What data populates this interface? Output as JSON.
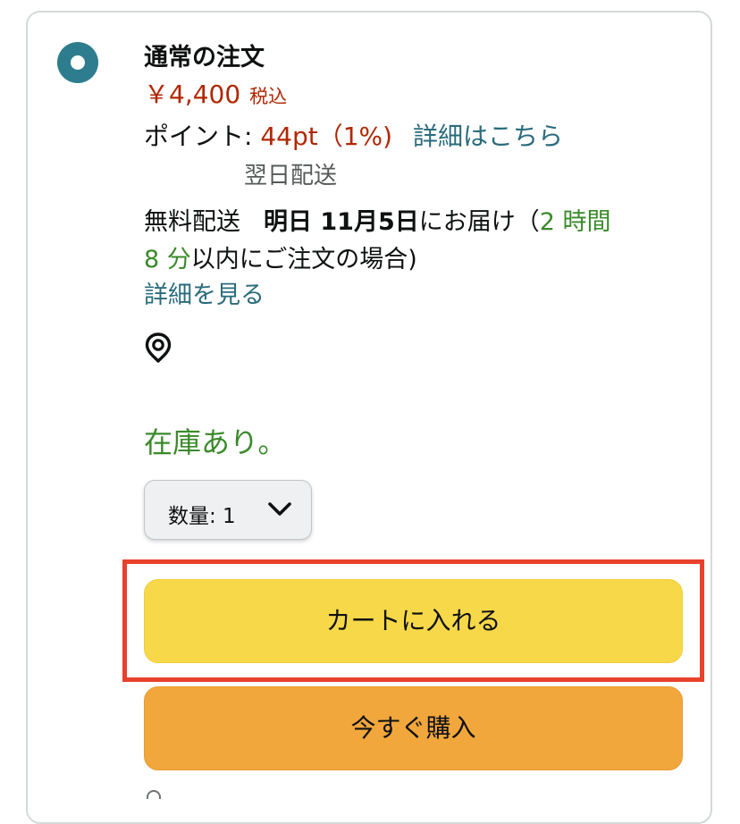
{
  "offer": {
    "title": "通常の注文",
    "price": "￥4,400",
    "tax_label": "税込",
    "points_label": "ポイント:",
    "points_value": "44pt（1%)",
    "points_link": "詳細はこちら",
    "next_day": "翌日配送",
    "delivery": {
      "free_label": "無料配送",
      "date": "明日 11月5日",
      "deliver_text": "にお届け（",
      "time_part1": "2 時間",
      "time_part2": "8 分",
      "order_text": "以内にご注文の場合)"
    },
    "details_link": "詳細を見る",
    "location_icon": "location-pin-icon",
    "stock": "在庫あり。",
    "quantity": {
      "label": "数量: 1"
    },
    "buttons": {
      "add_to_cart": "カートに入れる",
      "buy_now": "今すぐ購入"
    }
  },
  "colors": {
    "price": "#b12704",
    "link": "#2a6b7c",
    "stock": "#3a8a2a",
    "cart_button": "#f7d849",
    "buy_button": "#f2a73c",
    "highlight_box": "#e8412c",
    "radio": "#2d7d8e"
  }
}
